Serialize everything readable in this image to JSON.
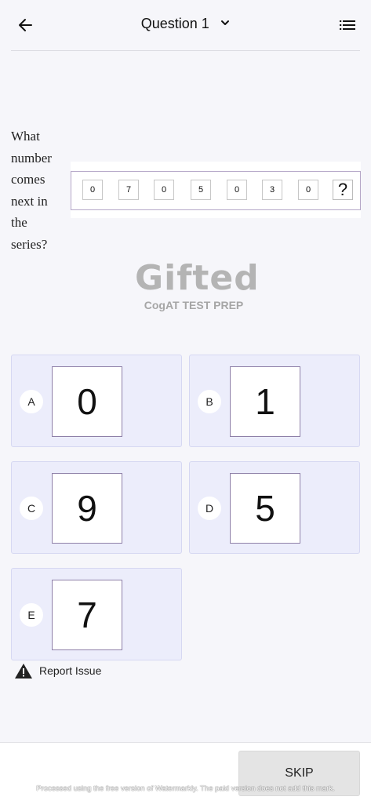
{
  "header": {
    "title": "Question 1"
  },
  "question": {
    "prompt": "What number comes next in the series?",
    "series": [
      "0",
      "7",
      "0",
      "5",
      "0",
      "3",
      "0",
      "?"
    ]
  },
  "logo": {
    "word": "Gifted",
    "subtitle": "CogAT TEST PREP"
  },
  "options": [
    {
      "letter": "A",
      "value": "0"
    },
    {
      "letter": "B",
      "value": "1"
    },
    {
      "letter": "C",
      "value": "9"
    },
    {
      "letter": "D",
      "value": "5"
    },
    {
      "letter": "E",
      "value": "7"
    }
  ],
  "report": {
    "label": "Report Issue"
  },
  "footer": {
    "skip_label": "SKIP",
    "watermark": "Processed using the free version of Watermarkly. The paid version does not add this mark."
  },
  "colors": {
    "option_background": "#ecedfb",
    "option_box_border": "#8e80a8",
    "series_border": "#b6a8c8",
    "skip_background": "#e4e4e4"
  },
  "icons": [
    "back-arrow-icon",
    "chevron-down-icon",
    "list-icon",
    "warning-icon"
  ]
}
